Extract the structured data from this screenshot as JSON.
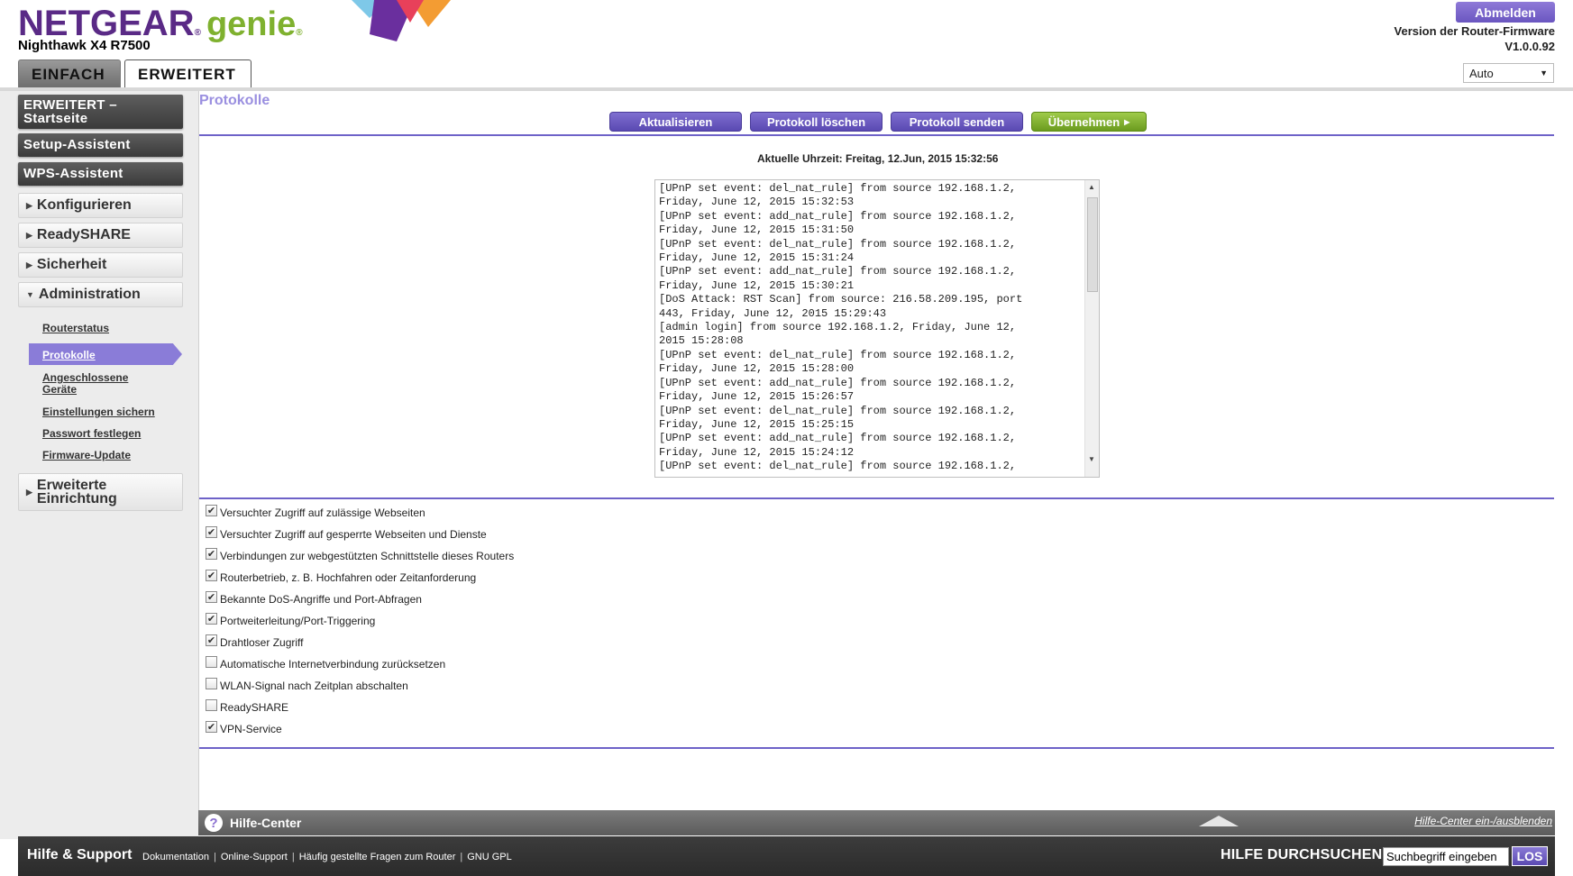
{
  "header": {
    "brand": "NETGEAR",
    "product": "genie",
    "model": "Nighthawk X4 R7500",
    "tabs": [
      "EINFACH",
      "ERWEITERT"
    ],
    "logout_label": "Abmelden",
    "firmware_label": "Version der Router-Firmware",
    "firmware_version": "V1.0.0.92",
    "language_value": "Auto",
    "colors": {
      "brand_purple": "#5a2a86",
      "genie_green": "#7fb12f",
      "accent": "#6e62c8"
    }
  },
  "sidebar": {
    "dark_items": [
      "ERWEITERT – Startseite",
      "Setup-Assistent",
      "WPS-Assistent"
    ],
    "sections": [
      "Konfigurieren",
      "ReadySHARE",
      "Sicherheit",
      "Administration",
      "Erweiterte Einrichtung"
    ],
    "sub_items": [
      "Routerstatus",
      "Protokolle",
      "Angeschlossene Geräte",
      "Einstellungen sichern",
      "Passwort festlegen",
      "Firmware-Update"
    ],
    "active_sub": "Protokolle"
  },
  "main": {
    "title": "Protokolle",
    "buttons": [
      "Aktualisieren",
      "Protokoll löschen",
      "Protokoll senden",
      "Übernehmen"
    ],
    "time_label": "Aktuelle Uhrzeit: Freitag, 12.Jun, 2015 15:32:56",
    "log_lines": [
      "[UPnP set event: del_nat_rule] from source 192.168.1.2,",
      "Friday, June 12, 2015 15:32:53",
      "[UPnP set event: add_nat_rule] from source 192.168.1.2,",
      "Friday, June 12, 2015 15:31:50",
      "[UPnP set event: del_nat_rule] from source 192.168.1.2,",
      "Friday, June 12, 2015 15:31:24",
      "[UPnP set event: add_nat_rule] from source 192.168.1.2,",
      "Friday, June 12, 2015 15:30:21",
      "[DoS Attack: RST Scan] from source: 216.58.209.195, port",
      "443, Friday, June 12, 2015 15:29:43",
      "[admin login] from source 192.168.1.2, Friday, June 12,",
      "2015 15:28:08",
      "[UPnP set event: del_nat_rule] from source 192.168.1.2,",
      "Friday, June 12, 2015 15:28:00",
      "[UPnP set event: add_nat_rule] from source 192.168.1.2,",
      "Friday, June 12, 2015 15:26:57",
      "[UPnP set event: del_nat_rule] from source 192.168.1.2,",
      "Friday, June 12, 2015 15:25:15",
      "[UPnP set event: add_nat_rule] from source 192.168.1.2,",
      "Friday, June 12, 2015 15:24:12",
      "[UPnP set event: del_nat_rule] from source 192.168.1.2,"
    ],
    "checkboxes": [
      {
        "label": "Versuchter Zugriff auf zulässige Webseiten",
        "checked": true
      },
      {
        "label": "Versuchter Zugriff auf gesperrte Webseiten und Dienste",
        "checked": true
      },
      {
        "label": "Verbindungen zur webgestützten Schnittstelle dieses Routers",
        "checked": true
      },
      {
        "label": "Routerbetrieb, z. B. Hochfahren oder Zeitanforderung",
        "checked": true
      },
      {
        "label": "Bekannte DoS-Angriffe und Port-Abfragen",
        "checked": true
      },
      {
        "label": "Portweiterleitung/Port-Triggering",
        "checked": true
      },
      {
        "label": "Drahtloser Zugriff",
        "checked": true
      },
      {
        "label": "Automatische Internetverbindung zurücksetzen",
        "checked": false
      },
      {
        "label": "WLAN-Signal nach Zeitplan abschalten",
        "checked": false
      },
      {
        "label": "ReadySHARE",
        "checked": false
      },
      {
        "label": "VPN-Service",
        "checked": true
      }
    ]
  },
  "help": {
    "title": "Hilfe-Center",
    "toggle": "Hilfe-Center ein-/ausblenden"
  },
  "footer": {
    "title": "Hilfe & Support",
    "links": [
      "Dokumentation",
      "Online-Support",
      "Häufig gestellte Fragen zum Router",
      "GNU GPL"
    ],
    "search_label": "HILFE DURCHSUCHEN",
    "search_placeholder": "Suchbegriff eingeben",
    "search_button": "LOS"
  }
}
